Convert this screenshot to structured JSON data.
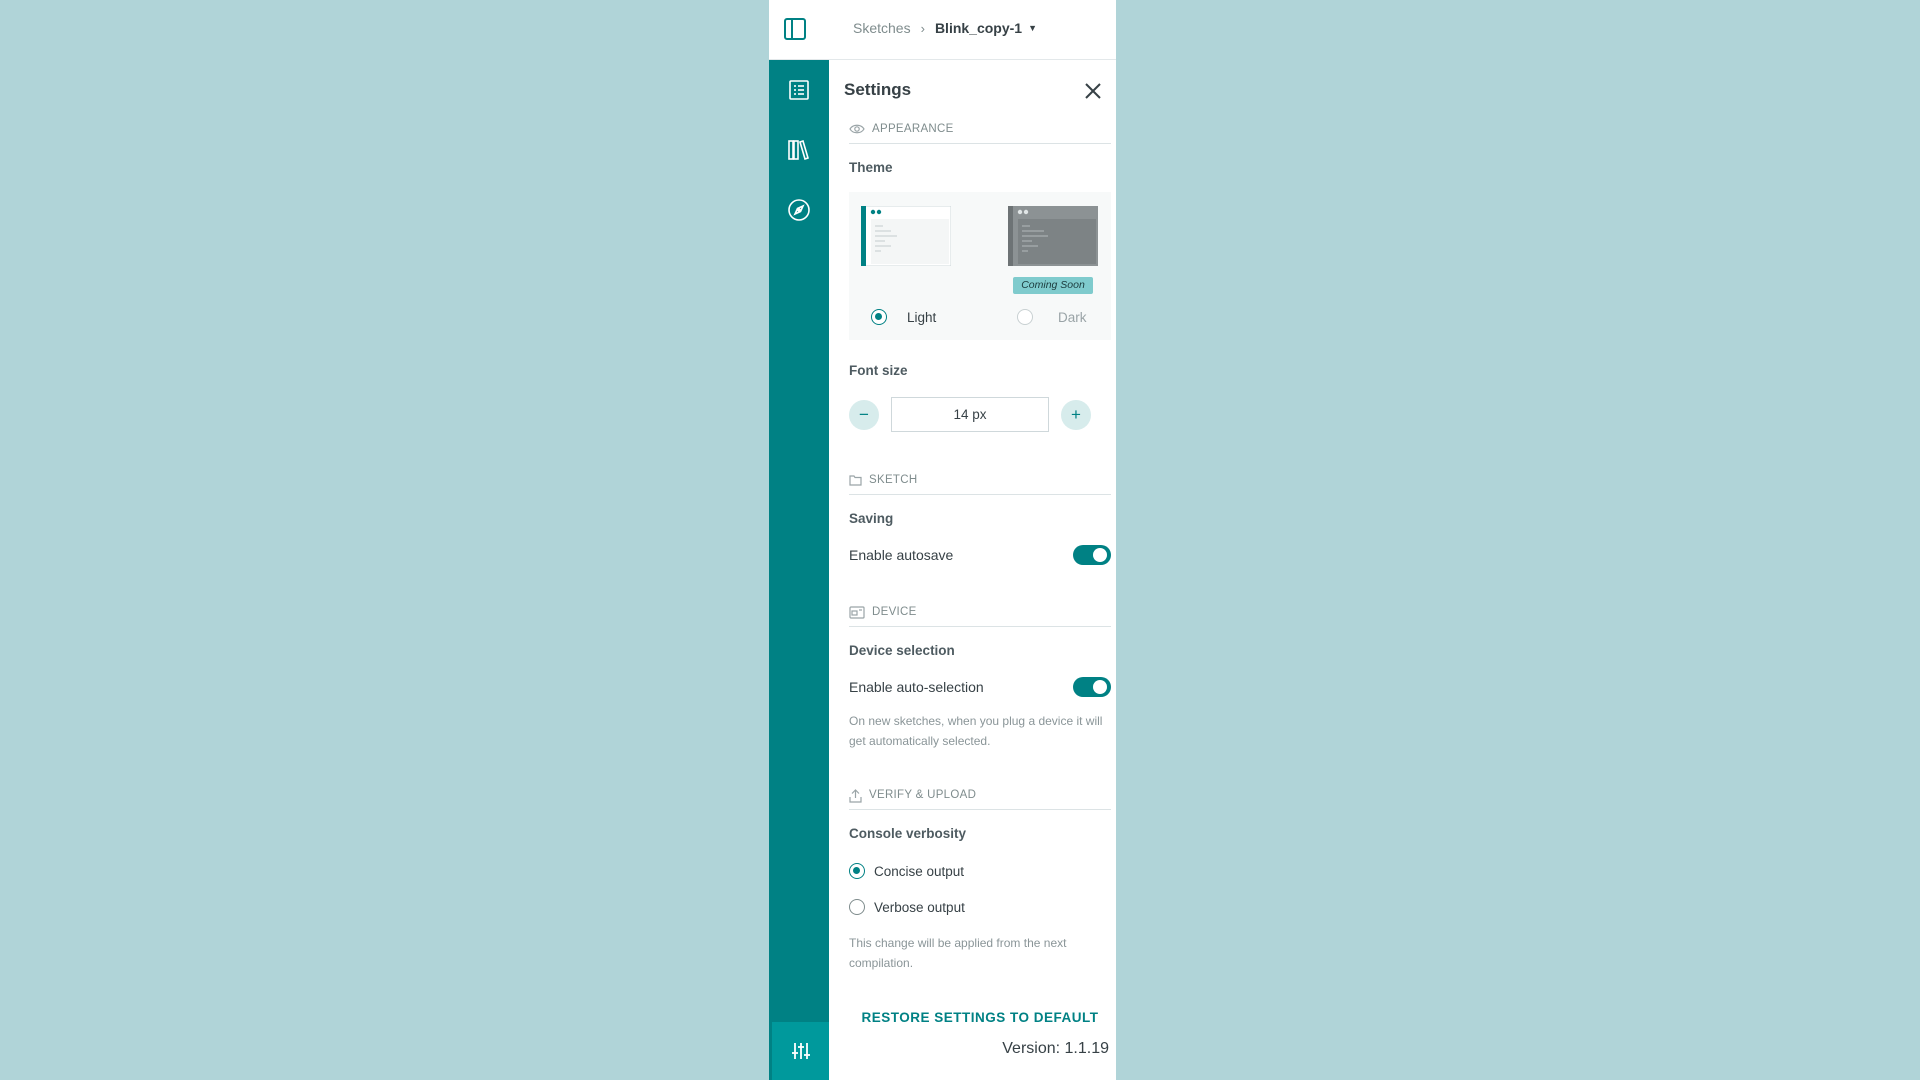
{
  "breadcrumb": {
    "root": "Sketches",
    "current": "Blink_copy-1"
  },
  "sidebar": {
    "items": [
      {
        "icon": "sketchbook-icon"
      },
      {
        "icon": "library-icon"
      },
      {
        "icon": "reference-compass-icon"
      }
    ],
    "bottom_icon": "settings-sliders-icon"
  },
  "settings": {
    "title": "Settings",
    "appearance": {
      "section_label": "APPEARANCE",
      "theme_label": "Theme",
      "themes": [
        {
          "label": "Light",
          "selected": true
        },
        {
          "label": "Dark",
          "selected": false,
          "badge": "Coming Soon"
        }
      ],
      "font_size_label": "Font size",
      "font_size_value": "14 px",
      "minus_label": "−",
      "plus_label": "+"
    },
    "sketch": {
      "section_label": "SKETCH",
      "saving_label": "Saving",
      "autosave_label": "Enable autosave",
      "autosave_on": true
    },
    "device": {
      "section_label": "DEVICE",
      "selection_label": "Device selection",
      "auto_selection_label": "Enable auto-selection",
      "auto_selection_on": true,
      "help": "On new sketches, when you plug a device it will get automatically selected."
    },
    "verify_upload": {
      "section_label": "VERIFY & UPLOAD",
      "verbosity_label": "Console verbosity",
      "options": [
        {
          "label": "Concise output",
          "selected": true
        },
        {
          "label": "Verbose output",
          "selected": false
        }
      ],
      "help": "This change will be applied from the next compilation."
    },
    "restore_label": "RESTORE SETTINGS TO DEFAULT",
    "version": "Version: 1.1.19"
  },
  "colors": {
    "accent": "#008184",
    "background": "#b0d4d8",
    "badge": "#7fcbcd"
  }
}
